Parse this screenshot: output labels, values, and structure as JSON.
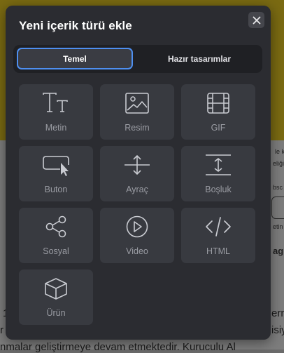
{
  "background": {
    "right_snippets": [
      "le ka",
      "eliğin",
      "bsc",
      "etin",
      "ag"
    ],
    "bottom_lines": [
      "1",
      "r",
      "nmalar geliştirmeye devam etmektedir. Kuruculu Al"
    ],
    "right_bottom": [
      "ern",
      "isiy"
    ]
  },
  "modal": {
    "title": "Yeni içerik türü ekle",
    "close_icon": "close-icon"
  },
  "tabs": [
    {
      "label": "Temel",
      "active": true
    },
    {
      "label": "Hazır tasarımlar",
      "active": false
    }
  ],
  "tiles": [
    {
      "label": "Metin",
      "icon": "text-icon"
    },
    {
      "label": "Resim",
      "icon": "image-icon"
    },
    {
      "label": "GIF",
      "icon": "gif-film-icon"
    },
    {
      "label": "Buton",
      "icon": "button-cursor-icon"
    },
    {
      "label": "Ayraç",
      "icon": "divider-icon"
    },
    {
      "label": "Boşluk",
      "icon": "spacer-icon"
    },
    {
      "label": "Sosyal",
      "icon": "share-icon"
    },
    {
      "label": "Video",
      "icon": "play-icon"
    },
    {
      "label": "HTML",
      "icon": "code-icon"
    },
    {
      "label": "Ürün",
      "icon": "box-icon"
    }
  ],
  "colors": {
    "modal_bg": "#2b2c31",
    "tile_bg": "#383a40",
    "accent": "#4e8ff0",
    "icon": "#c9cbd1",
    "label": "#9a9ca3"
  }
}
